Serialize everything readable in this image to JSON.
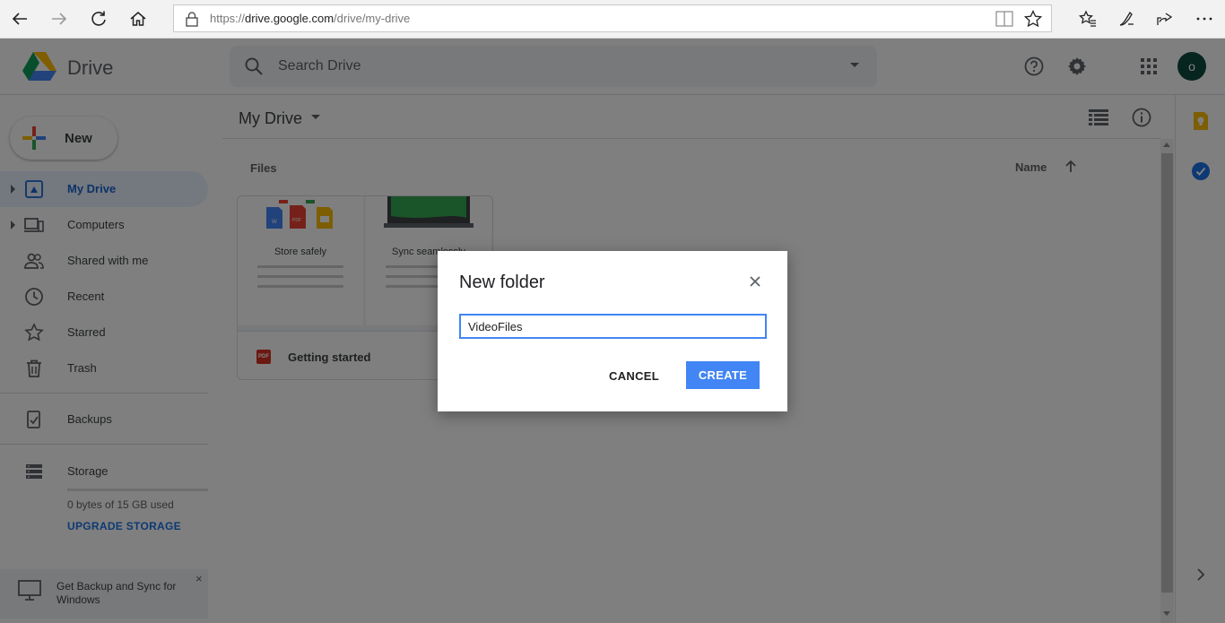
{
  "browser": {
    "url_base": "https://",
    "url_host": "drive.google.com",
    "url_path": "/drive/my-drive",
    "icons": [
      "back-icon",
      "forward-icon",
      "refresh-icon",
      "home-icon",
      "lock-icon",
      "reading-view-icon",
      "favorite-star-icon",
      "favorites-bar-icon",
      "pen-icon",
      "share-icon",
      "more-icon"
    ]
  },
  "header": {
    "brand": "Drive",
    "search_placeholder": "Search Drive",
    "avatar_initial": "o",
    "avatar_color": "#0d4a3c"
  },
  "sidebar": {
    "new_label": "New",
    "items": [
      {
        "label": "My Drive",
        "icon": "my-drive-icon",
        "active": true,
        "expandable": true
      },
      {
        "label": "Computers",
        "icon": "computers-icon",
        "active": false,
        "expandable": true
      },
      {
        "label": "Shared with me",
        "icon": "shared-icon",
        "active": false,
        "expandable": false
      },
      {
        "label": "Recent",
        "icon": "clock-icon",
        "active": false,
        "expandable": false
      },
      {
        "label": "Starred",
        "icon": "star-icon",
        "active": false,
        "expandable": false
      },
      {
        "label": "Trash",
        "icon": "trash-icon",
        "active": false,
        "expandable": false
      },
      {
        "label": "Backups",
        "icon": "backups-icon",
        "active": false,
        "expandable": false
      },
      {
        "label": "Storage",
        "icon": "storage-icon",
        "active": false,
        "expandable": false
      }
    ],
    "storage_used": "0 bytes of 15 GB used",
    "upgrade_label": "UPGRADE STORAGE",
    "promo_text": "Get Backup and Sync for Windows",
    "promo_close": "×"
  },
  "main": {
    "title": "My Drive",
    "section_label": "Files",
    "sort_label": "Name",
    "file": {
      "name": "Getting started",
      "type": "PDF",
      "thumb_left_title": "Store safely",
      "thumb_right_title": "Sync seamlessly"
    }
  },
  "dialog": {
    "title": "New folder",
    "input_value": "VideoFiles",
    "cancel_label": "CANCEL",
    "create_label": "CREATE",
    "accent": "#4285f4"
  }
}
